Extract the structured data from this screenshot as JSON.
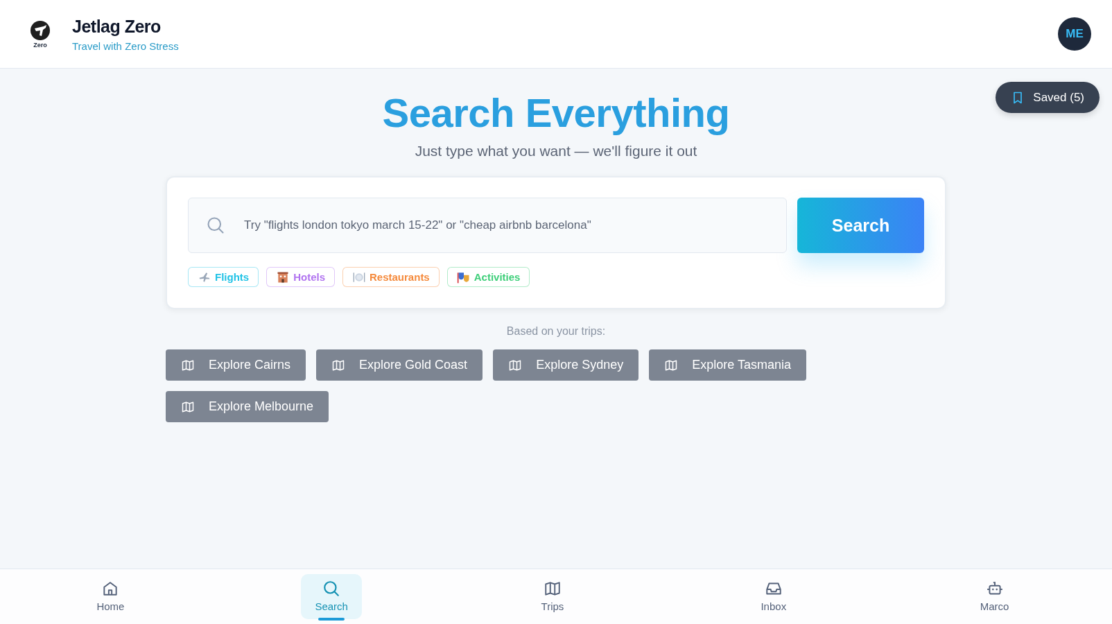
{
  "header": {
    "logo_text": "Zero",
    "title": "Jetlag Zero",
    "subtitle": "Travel with Zero Stress",
    "avatar": "ME"
  },
  "saved_button": {
    "label": "Saved (5)"
  },
  "hero": {
    "title": "Search Everything",
    "subtitle": "Just type what you want — we'll figure it out"
  },
  "search": {
    "placeholder": "Try \"flights london tokyo march 15-22\" or \"cheap airbnb barcelona\"",
    "button": "Search"
  },
  "categories": [
    {
      "kind": "flights",
      "label": "Flights",
      "color": "#22c3e6"
    },
    {
      "kind": "hotels",
      "label": "Hotels",
      "color": "#b174f0"
    },
    {
      "kind": "restaurants",
      "label": "Restaurants",
      "color": "#f58a3c"
    },
    {
      "kind": "activities",
      "label": "Activities",
      "color": "#3fcf7a"
    }
  ],
  "suggestions_label": "Based on your trips:",
  "suggestions": [
    "Explore Cairns",
    "Explore Gold Coast",
    "Explore Sydney",
    "Explore Tasmania",
    "Explore Melbourne"
  ],
  "nav": [
    {
      "kind": "home",
      "label": "Home",
      "selected": false
    },
    {
      "kind": "search",
      "label": "Search",
      "selected": true
    },
    {
      "kind": "trips",
      "label": "Trips",
      "selected": false
    },
    {
      "kind": "inbox",
      "label": "Inbox",
      "selected": false
    },
    {
      "kind": "bot",
      "label": "Marco",
      "selected": false
    }
  ]
}
